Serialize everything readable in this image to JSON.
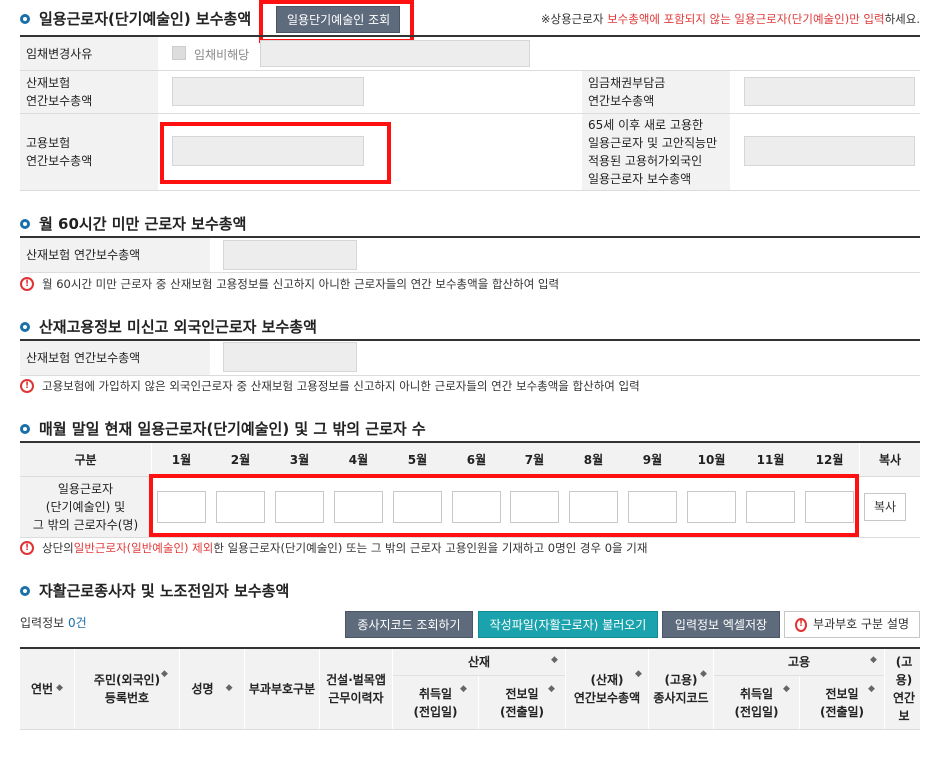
{
  "section1": {
    "title": "일용근로자(단기예술인) 보수총액",
    "query_button": "일용단기예술인 조회",
    "note_prefix": "※상용근로자 ",
    "note_red": "보수총액에 포함되지 않는 일용근로자(단기예술인)만 입력",
    "note_suffix": "하세요.",
    "row1_label": "임채변경사유",
    "row1_checkbox": "임채비해당",
    "row2_label_left": "산재보험\n연간보수총액",
    "row2_label_right": "임금채권부담금\n연간보수총액",
    "row3_label_left": "고용보험\n연간보수총액",
    "row3_label_right": "65세 이후 새로 고용한\n일용근로자 및 고안직능만\n적용된 고용허가외국인\n일용근로자 보수총액"
  },
  "section2": {
    "title": "월 60시간 미만 근로자 보수총액",
    "label": "산재보험 연간보수총액",
    "warning": "월 60시간 미만 근로자 중 산재보험 고용정보를 신고하지 아니한 근로자들의 연간 보수총액을 합산하여 입력"
  },
  "section3": {
    "title": "산재고용정보 미신고 외국인근로자 보수총액",
    "label": "산재보험 연간보수총액",
    "warning": "고용보험에 가입하지 않은 외국인근로자 중 산재보험 고용정보를 신고하지 아니한 근로자들의 연간 보수총액을 합산하여 입력"
  },
  "section4": {
    "title": "매월 말일 현재 일용근로자(단기예술인) 및 그 밖의 근로자 수",
    "head_label": "구분",
    "months": [
      "1월",
      "2월",
      "3월",
      "4월",
      "5월",
      "6월",
      "7월",
      "8월",
      "9월",
      "10월",
      "11월",
      "12월"
    ],
    "copy_header": "복사",
    "row_label": "일용근로자\n(단기예술인) 및\n그 밖의  근로자수(명)",
    "copy_button": "복사",
    "warn_prefix": "상단의 ",
    "warn_red": "일반근로자(일반예술인) 제외",
    "warn_suffix": "한 일용근로자(단기예술인) 또는 그 밖의 근로자 고용인원을 기재하고 0명인 경우 0을 기재"
  },
  "section5": {
    "title": "자활근로종사자 및 노조전임자 보수총액",
    "count_label": "입력정보 ",
    "count_value": "0건",
    "btn_lookup": "종사지코드 조회하기",
    "btn_load": "작성파일(자활근로자) 불러오기",
    "btn_excel": "입력정보 엑셀저장",
    "btn_help": "부과부호 구분 설명",
    "cols": {
      "seq": "연번",
      "rrn": "주민(외국인)\n등록번호",
      "name": "성명",
      "code": "부과부호구분",
      "const": "건설·벌목앱\n근무이력자",
      "sanjae": "산재",
      "s_acq": "취득일\n(전입일)",
      "s_loss": "전보일\n(전출일)",
      "s_total": "(산재)\n연간보수총액",
      "g_code": "(고용)\n종사지코드",
      "goyong": "고용",
      "g_acq": "취득일\n(전입일)",
      "g_loss": "전보일\n(전출일)",
      "g_total": "(고용)\n연간보"
    }
  },
  "colors": {
    "accent": "#1b6fa8",
    "red": "#e03a3a",
    "teal": "#1aa3ad",
    "slate": "#5e6b7d"
  },
  "icons": {
    "sort": "sort-icon",
    "warning": "warning-icon",
    "bullet": "section-bullet-icon"
  }
}
